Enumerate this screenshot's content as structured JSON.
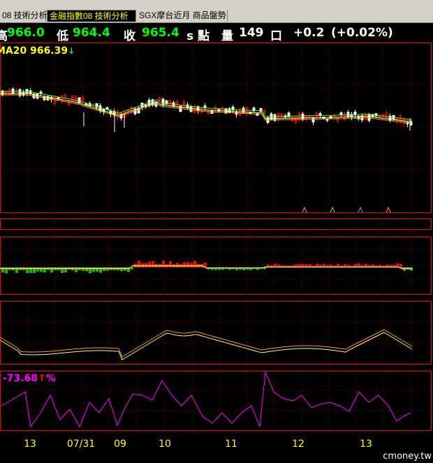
{
  "tabs": [
    {
      "label": "08 技術分析",
      "active": false
    },
    {
      "label": "金融指數08 技術分析",
      "active": true
    },
    {
      "label": "SGX摩台近月 商品盤勢",
      "active": false
    }
  ],
  "quote": {
    "high_label": "高",
    "high_value": "966.0",
    "low_label": "低",
    "low_value": "964.4",
    "close_label": "收",
    "close_value": "965.4",
    "unit_label": "s 點",
    "volume_label": "量",
    "volume_value": "149",
    "volume_unit": "口",
    "change": "+0.2",
    "change_pct": "(+0.02%)"
  },
  "ma_label": {
    "name": "MA20",
    "value": "966.39",
    "arrow": "↓",
    "color": "#ffff00",
    "arrow_color": "#00ff00"
  },
  "osc_label": {
    "value": "-73.68",
    "arrow": "↑",
    "unit": "%",
    "color": "#ff00ff",
    "arrow_color": "#ff0000"
  },
  "x_axis_labels": [
    "13",
    "07/31",
    "09",
    "10",
    "11",
    "12",
    "13"
  ],
  "watermark": "cmoney.tw",
  "colors": {
    "grid": "#ff0000",
    "frame": "#ff0000",
    "text_axis": "#ffff00",
    "up_candle": "#ff0000",
    "down_candle": "#ffffff",
    "histogram_pos": "#ff0000",
    "histogram_neg": "#00c000",
    "line_orange": "#ff9933",
    "line_yellow": "#ffff66",
    "line_magenta": "#ff00ff",
    "ma_green": "#33ff33"
  }
}
